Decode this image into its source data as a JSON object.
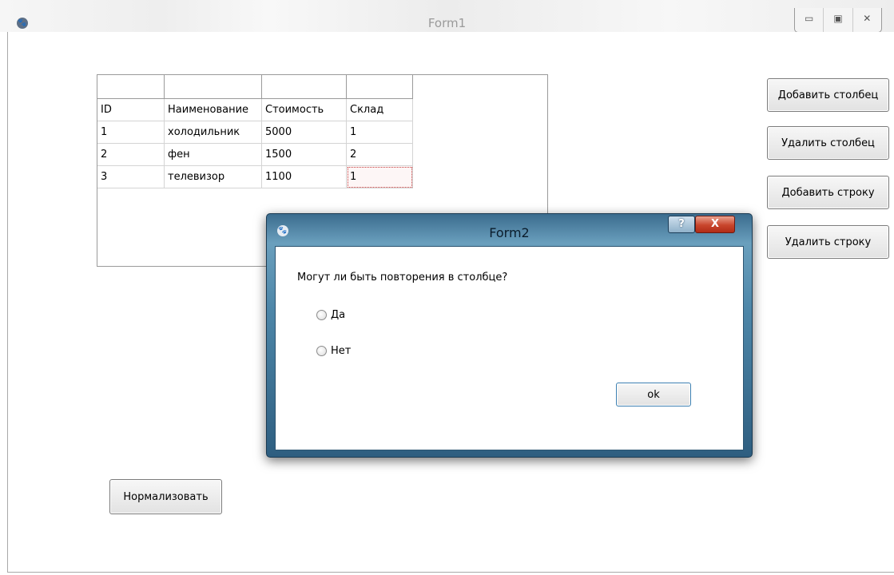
{
  "form1": {
    "title": "Form1",
    "app_icon": "paw-icon",
    "controls": {
      "minimize": "▭",
      "maximize": "▣",
      "close": "✕"
    },
    "grid": {
      "header_row": [
        "",
        "",
        "",
        ""
      ],
      "rows": [
        [
          "ID",
          "Наименование",
          "Стоимость",
          "Склад"
        ],
        [
          "1",
          "холодильник",
          "5000",
          "1"
        ],
        [
          "2",
          "фен",
          "1500",
          "2"
        ],
        [
          "3",
          "телевизор",
          "1100",
          "1"
        ]
      ]
    },
    "buttons": {
      "add_column": "Добавить столбец",
      "delete_column": "Удалить столбец",
      "add_row": "Добавить строку",
      "delete_row": "Удалить строку",
      "normalize": "Нормализовать"
    }
  },
  "form2": {
    "title": "Form2",
    "app_icon": "paw-icon",
    "help_label": "?",
    "close_label": "X",
    "question": "Могут ли быть повторения в столбце?",
    "options": [
      "Да",
      "Нет"
    ],
    "ok_label": "ok"
  }
}
